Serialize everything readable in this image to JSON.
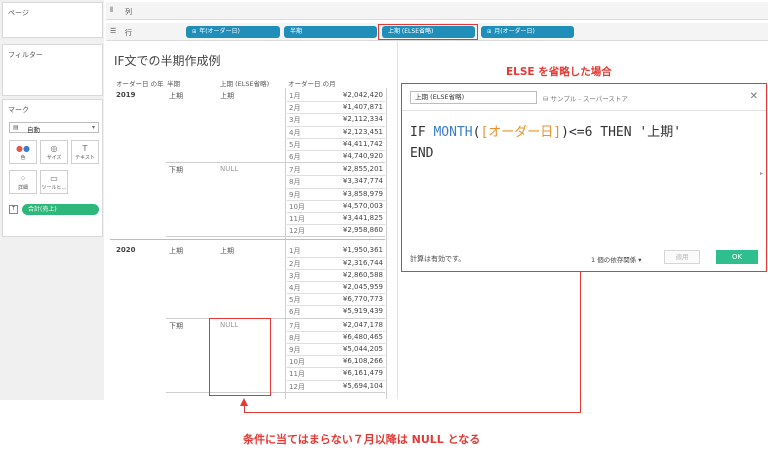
{
  "panes": {
    "pages": "ページ",
    "filters": "フィルター",
    "marks": "マーク"
  },
  "marks": {
    "type": "自動",
    "buttons": [
      "色",
      "サイズ",
      "テキスト",
      "詳細",
      "ツールヒ…"
    ],
    "field": "合計(売上)",
    "field_type": "T"
  },
  "shelves": {
    "columns_label": "列",
    "rows_label": "行",
    "rows_pills": [
      "年(オーダー日)",
      "半期",
      "上期 (ELSE省略)",
      "月(オーダー日)"
    ]
  },
  "sheet": {
    "title": "IF文での半期作成例",
    "headers": [
      "オーダー日 の年",
      "半期",
      "上期 (ELSE省略)",
      "オーダー日 の月"
    ],
    "groups": [
      {
        "year": "2019",
        "halves": [
          {
            "half": "上期",
            "flag": "上期",
            "months": [
              "1月",
              "2月",
              "3月",
              "4月",
              "5月",
              "6月"
            ],
            "values": [
              "¥2,042,420",
              "¥1,407,871",
              "¥2,112,334",
              "¥2,123,451",
              "¥4,411,742",
              "¥4,740,920"
            ]
          },
          {
            "half": "下期",
            "flag": "NULL",
            "months": [
              "7月",
              "8月",
              "9月",
              "10月",
              "11月",
              "12月"
            ],
            "values": [
              "¥2,855,201",
              "¥3,347,774",
              "¥3,858,979",
              "¥4,570,003",
              "¥3,441,825",
              "¥2,958,860"
            ]
          }
        ]
      },
      {
        "year": "2020",
        "halves": [
          {
            "half": "上期",
            "flag": "上期",
            "months": [
              "1月",
              "2月",
              "3月",
              "4月",
              "5月",
              "6月"
            ],
            "values": [
              "¥1,950,361",
              "¥2,316,744",
              "¥2,860,588",
              "¥2,045,959",
              "¥6,770,773",
              "¥5,919,439"
            ]
          },
          {
            "half": "下期",
            "flag": "NULL",
            "months": [
              "7月",
              "8月",
              "9月",
              "10月",
              "11月",
              "12月"
            ],
            "values": [
              "¥2,047,178",
              "¥6,480,465",
              "¥5,044,205",
              "¥6,108,266",
              "¥6,161,479",
              "¥5,694,104"
            ]
          }
        ]
      }
    ]
  },
  "dialog": {
    "calc_name": "上期 (ELSE省略)",
    "datasource": "サンプル - スーパーストア",
    "code": {
      "if": "IF ",
      "fn": "MONTH",
      "open": "(",
      "field": "[オーダー日]",
      "rest": ")<=6 THEN '上期'",
      "end": "END"
    },
    "status": "計算は有効です。",
    "dependencies": "1 個の依存関係 ▾",
    "apply": "適用",
    "ok": "OK"
  },
  "annotations": {
    "title": "ELSE を省略した場合",
    "note": "条件に当てはまらない７月以降は NULL となる"
  },
  "colors": {
    "accent_red": "#e53935",
    "pill_blue": "#1f8fba",
    "measure_green": "#2db87a",
    "ok_green": "#2fbf8f"
  }
}
